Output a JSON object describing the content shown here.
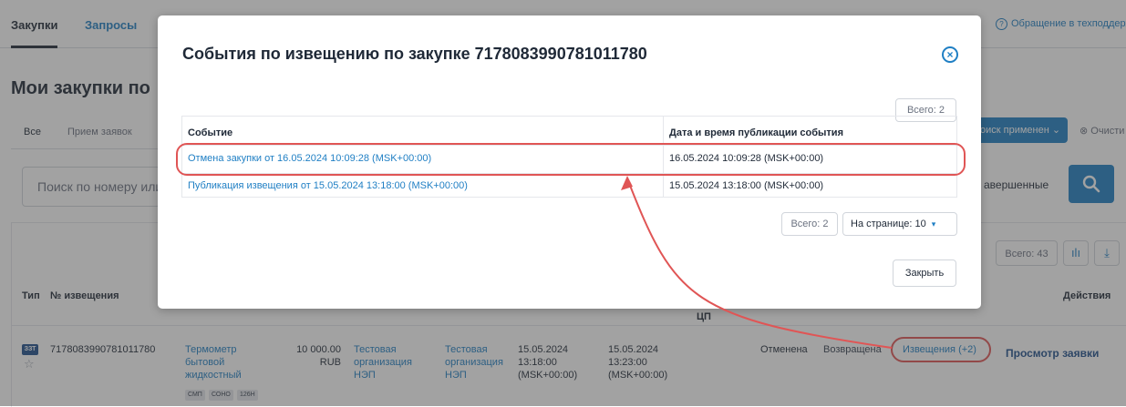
{
  "nav": {
    "tabs": [
      "Закупки",
      "Запросы"
    ],
    "support_text": "Обращение в техподдерж"
  },
  "page": {
    "title": "Мои закупки по ",
    "subtabs": [
      "Все",
      "Прием заявок"
    ],
    "search_placeholder": "Поиск по номеру или",
    "filter_button": "оиск применен",
    "clear_link": "Очисти",
    "completed_label": "авершенные",
    "total": "Всего: 43"
  },
  "table": {
    "headers": {
      "type": "Тип",
      "number": "№ извещения",
      "cp": "ЦП",
      "actions": "Действия"
    },
    "row": {
      "type_badge": "ЗЗТ",
      "number": "7178083990781011780",
      "name": [
        "Термометр",
        "бытовой",
        "жидкостный"
      ],
      "tags": [
        "СМП",
        "СОНО",
        "126Н"
      ],
      "price": "10 000.00",
      "currency": "RUB",
      "customer": [
        "Тестовая",
        "организация",
        "НЭП"
      ],
      "organizer": [
        "Тестовая",
        "организация",
        "НЭП"
      ],
      "date1": [
        "15.05.2024",
        "13:18:00",
        "(MSK+00:00)"
      ],
      "date2": [
        "15.05.2024",
        "13:23:00",
        "(MSK+00:00)"
      ],
      "status": "Отменена",
      "status2": "Возвращена",
      "notices_link": "Извещения (+2)",
      "view_link": "Просмотр заявки"
    }
  },
  "modal": {
    "title": "События по извещению по закупке 7178083990781011780",
    "total_top": "Всего: 2",
    "columns": [
      "Событие",
      "Дата и время публикации события"
    ],
    "rows": [
      {
        "event": "Отмена закупки от 16.05.2024 10:09:28 (MSK+00:00)",
        "published": "16.05.2024 10:09:28 (MSK+00:00)"
      },
      {
        "event": "Публикация извещения от 15.05.2024 13:18:00 (MSK+00:00)",
        "published": "15.05.2024 13:18:00 (MSK+00:00)"
      }
    ],
    "total_bottom": "Всего: 2",
    "per_page": "На странице: 10",
    "close_button": "Закрыть"
  },
  "colors": {
    "link": "#1f7fc4",
    "primary": "#1f7fc4",
    "highlight": "#e05555",
    "overlay": "rgba(60,60,60,0.48)"
  },
  "icons": [
    "support-icon",
    "search-icon",
    "chart-icon",
    "download-icon",
    "star-icon",
    "close-icon",
    "chevron-down-icon"
  ]
}
